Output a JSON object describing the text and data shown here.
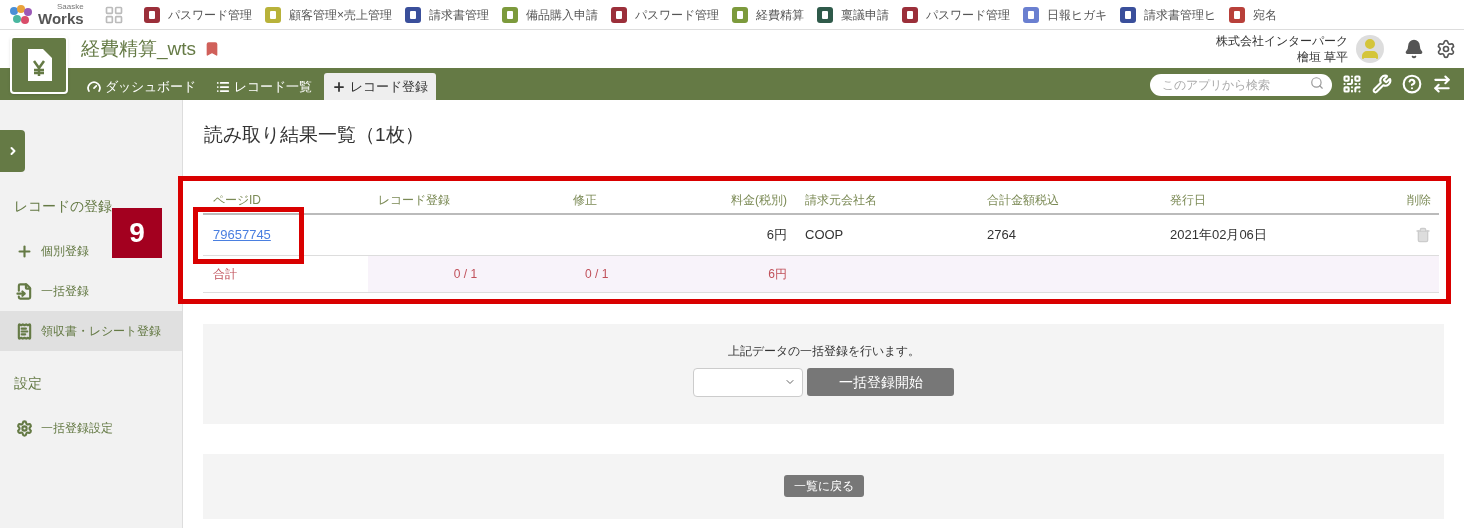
{
  "top_bar": {
    "brand_small": "Saaske",
    "brand": "Works",
    "apps": [
      {
        "label": "パスワード管理",
        "color": "#9b2f3a"
      },
      {
        "label": "顧客管理×売上管理",
        "color": "#b8b23a"
      },
      {
        "label": "請求書管理",
        "color": "#3a4f9b"
      },
      {
        "label": "備品購入申請",
        "color": "#7c9a3c"
      },
      {
        "label": "パスワード管理",
        "color": "#9b2f3a"
      },
      {
        "label": "経費精算",
        "color": "#7c9a3c"
      },
      {
        "label": "稟議申請",
        "color": "#2f5a4a"
      },
      {
        "label": "パスワード管理",
        "color": "#9b2f3a"
      },
      {
        "label": "日報ヒガキ",
        "color": "#6a7fd0"
      },
      {
        "label": "請求書管理ヒ",
        "color": "#3a4f9b"
      },
      {
        "label": "宛名",
        "color": "#b8403a"
      }
    ]
  },
  "header": {
    "app_title": "経費精算_wts",
    "company": "株式会社インターパーク",
    "user_name": "檜垣 草平"
  },
  "nav_tabs": [
    {
      "label": "ダッシュボード",
      "selected": false
    },
    {
      "label": "レコード一覧",
      "selected": false
    },
    {
      "label": "レコード登録",
      "selected": true
    }
  ],
  "search": {
    "placeholder": "このアプリから検索"
  },
  "sidebar": {
    "sections": [
      {
        "heading": "レコードの登録",
        "items": [
          {
            "label": "個別登録",
            "selected": false
          },
          {
            "label": "一括登録",
            "selected": false
          },
          {
            "label": "領収書・レシート登録",
            "selected": true
          }
        ]
      },
      {
        "heading": "設定",
        "items": [
          {
            "label": "一括登録設定",
            "selected": false
          }
        ]
      }
    ]
  },
  "page_title": "読み取り結果一覧（1枚）",
  "table": {
    "columns": [
      "ページID",
      "レコード登録",
      "修正",
      "料金(税別)",
      "請求元会社名",
      "合計金額税込",
      "発行日",
      "削除"
    ],
    "rows": [
      {
        "page_id": "79657745",
        "record": "",
        "fix": "",
        "fee": "6円",
        "company": "COOP",
        "total": "2764",
        "date": "2021年02月06日"
      }
    ],
    "total_row": {
      "label": "合計",
      "record": "0 / 1",
      "fix": "0 / 1",
      "fee": "6円"
    }
  },
  "annotation": {
    "badge": "9"
  },
  "bulk": {
    "message": "上記データの一括登録を行います。",
    "button": "一括登録開始"
  },
  "back_button": "一覧に戻る"
}
